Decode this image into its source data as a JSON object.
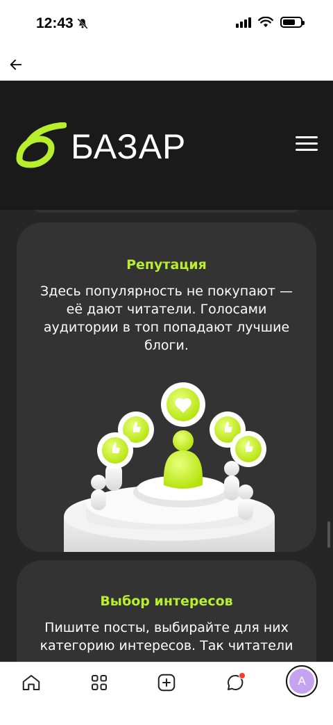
{
  "status_bar": {
    "time": "12:43"
  },
  "header": {
    "logo_text": "БАЗАР"
  },
  "cards": [
    {
      "title": "Репутация",
      "text": "Здесь популярность не покупают — её дают читатели. Голосами аудитории в топ попадают лучшие блоги."
    },
    {
      "title": "Выбор интересов",
      "text": "Пишите посты, выбирайте для них категорию интересов. Так читатели"
    }
  ],
  "tab_bar": {
    "avatar_letter": "А"
  },
  "colors": {
    "accent": "#b8ef2c",
    "header_bg": "#1a1a1a",
    "card_bg": "#333334",
    "avatar_bg": "#c6a3f0",
    "notification": "#ff3b30"
  }
}
